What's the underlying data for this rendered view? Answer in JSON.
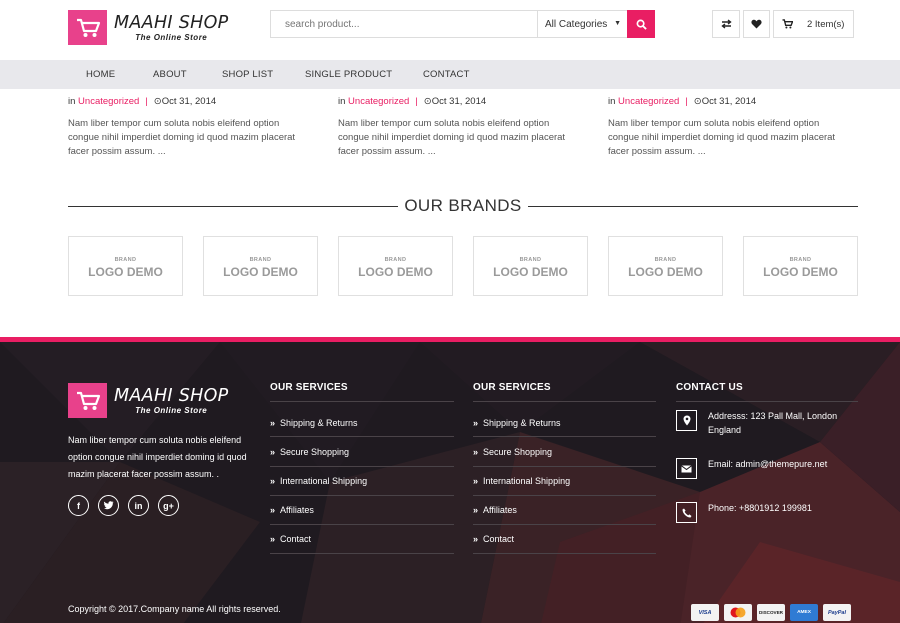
{
  "header": {
    "brand_name": "MAAHI SHOP",
    "brand_tagline": "The Online Store",
    "search_placeholder": "search product...",
    "category_selected": "All Categories",
    "cart_label": "2 Item(s)"
  },
  "nav": {
    "items": [
      "HOME",
      "ABOUT",
      "SHOP LIST",
      "SINGLE PRODUCT",
      "CONTACT"
    ]
  },
  "posts": [
    {
      "prefix": "in",
      "category": "Uncategorized",
      "date": "Oct 31, 2014",
      "excerpt": "Nam liber tempor cum soluta nobis eleifend option congue nihil imperdiet doming id quod mazim placerat facer possim assum. ..."
    },
    {
      "prefix": "in",
      "category": "Uncategorized",
      "date": "Oct 31, 2014",
      "excerpt": "Nam liber tempor cum soluta nobis eleifend option congue nihil imperdiet doming id quod mazim placerat facer possim assum. ..."
    },
    {
      "prefix": "in",
      "category": "Uncategorized",
      "date": "Oct 31, 2014",
      "excerpt": "Nam liber tempor cum soluta nobis eleifend option congue nihil imperdiet doming id quod mazim placerat facer possim assum. ..."
    }
  ],
  "brands": {
    "heading": "OUR BRANDS",
    "items": [
      {
        "small": "BRAND",
        "big": "LOGO DEMO"
      },
      {
        "small": "BRAND",
        "big": "LOGO DEMO"
      },
      {
        "small": "BRAND",
        "big": "LOGO DEMO"
      },
      {
        "small": "BRAND",
        "big": "LOGO DEMO"
      },
      {
        "small": "BRAND",
        "big": "LOGO DEMO"
      },
      {
        "small": "BRAND",
        "big": "LOGO DEMO"
      }
    ]
  },
  "footer": {
    "brand_name": "MAAHI SHOP",
    "brand_tagline": "The Online Store",
    "about": "Nam liber tempor cum soluta nobis eleifend option congue nihil imperdiet doming id quod mazim placerat facer possim assum. .",
    "social_icons": [
      "facebook-icon",
      "twitter-icon",
      "linkedin-icon",
      "google-plus-icon"
    ],
    "services_1": {
      "heading": "OUR SERVICES",
      "links": [
        "Shipping & Returns",
        "Secure Shopping",
        "International Shipping",
        "Affiliates",
        "Contact"
      ]
    },
    "services_2": {
      "heading": "OUR SERVICES",
      "links": [
        "Shipping & Returns",
        "Secure Shopping",
        "International Shipping",
        "Affiliates",
        "Contact"
      ]
    },
    "contact": {
      "heading": "CONTACT US",
      "address": "Addresss: 123 Pall Mall, London England",
      "email": "Email: admin@themepure.net",
      "phone": "Phone: +8801912 199981"
    },
    "copyright": "Copyright © 2017.Company name All rights reserved.",
    "payment_cards": [
      "VISA",
      "MC",
      "DISCOVER",
      "AMEX",
      "PayPal"
    ]
  },
  "colors": {
    "accent": "#e91e63",
    "logo_pink": "#e8418b",
    "nav_bg": "#e8e8ec",
    "footer_bg": "#1f1a20"
  }
}
